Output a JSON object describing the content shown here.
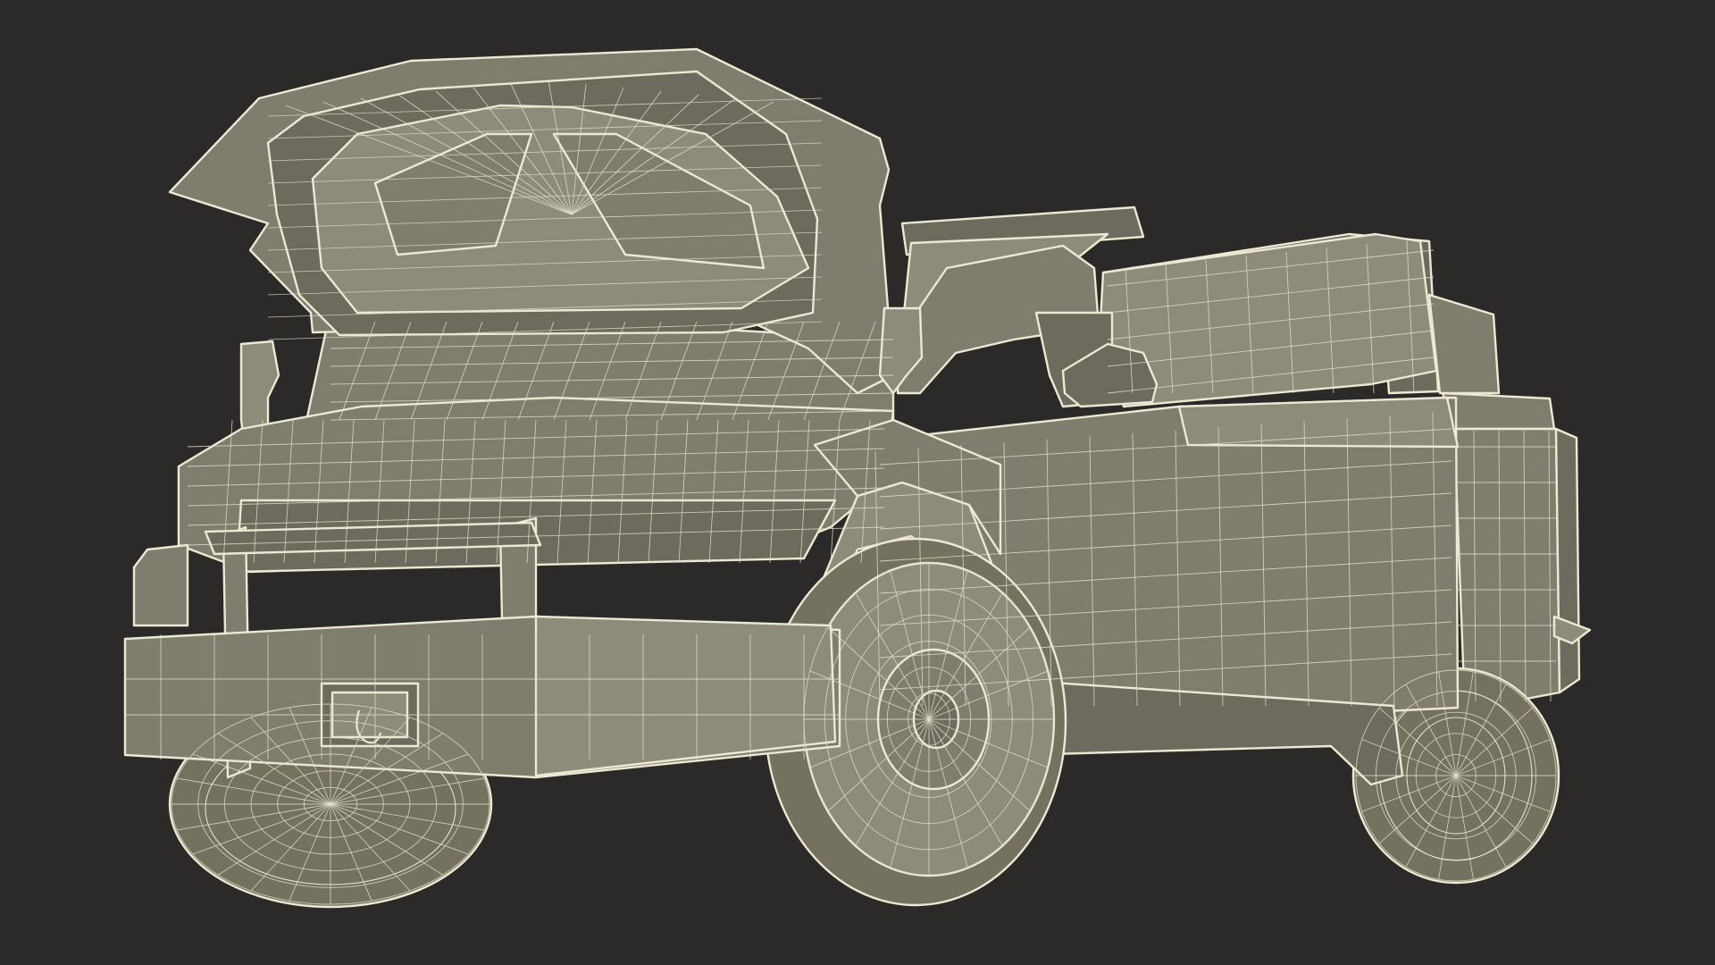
{
  "scene": {
    "subject": "armored-pickup-truck-wireframe",
    "colors": {
      "background": "#2b2a28",
      "body": "#7f7d6d",
      "body_light": "#8d8b7a",
      "body_dark": "#6d6b5d",
      "tire": "#74725f",
      "wire": "#e4e0cc"
    },
    "parts": [
      "open-hood",
      "windshield",
      "cab-roof",
      "front-fender",
      "side-door-panel",
      "rear-bed",
      "front-bull-bar",
      "winch",
      "tow-hook",
      "front-left-wheel",
      "front-right-wheel",
      "rear-wheel",
      "snorkel",
      "side-mirror"
    ]
  }
}
